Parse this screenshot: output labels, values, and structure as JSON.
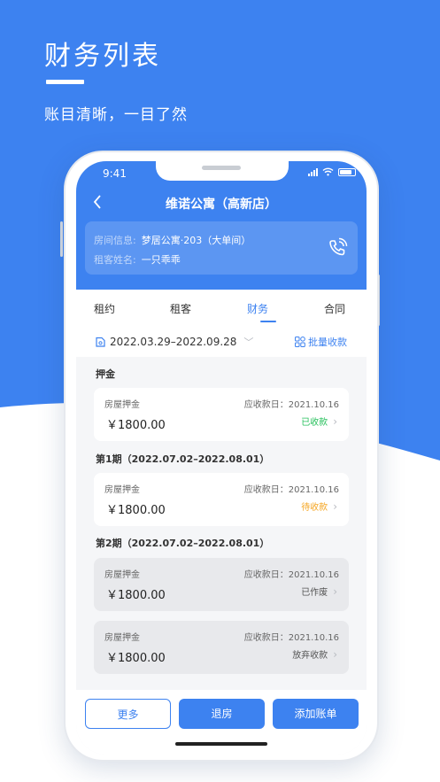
{
  "colors": {
    "brand_blue": "#3d82f0",
    "paid_green": "#27c05c",
    "pending_orange": "#f5a623"
  },
  "promo": {
    "title": "财务列表",
    "subtitle": "账目清晰，一目了然"
  },
  "status_bar": {
    "time": "9:41"
  },
  "header": {
    "title": "维诺公寓（高新店）",
    "room_label": "房间信息:",
    "room_value": "梦居公寓·203（大单间）",
    "tenant_label": "租客姓名:",
    "tenant_value": "一只乖乖"
  },
  "tabs": [
    {
      "label": "租约",
      "active": false
    },
    {
      "label": "租客",
      "active": false
    },
    {
      "label": "财务",
      "active": true
    },
    {
      "label": "合同",
      "active": false
    }
  ],
  "filter": {
    "date_range": "2022.03.29–2022.09.28",
    "batch_label": "批量收款"
  },
  "sections": [
    {
      "title": "押金",
      "items": [
        {
          "name": "房屋押金",
          "due": "应收款日：2021.10.16",
          "amount": "￥1800.00",
          "status": "已收款",
          "state": "paid"
        }
      ]
    },
    {
      "title": "第1期（2022.07.02–2022.08.01）",
      "items": [
        {
          "name": "房屋押金",
          "due": "应收款日：2021.10.16",
          "amount": "￥1800.00",
          "status": "待收款",
          "state": "pending"
        }
      ]
    },
    {
      "title": "第2期（2022.07.02–2022.08.01）",
      "items": [
        {
          "name": "房屋押金",
          "due": "应收款日：2021.10.16",
          "amount": "￥1800.00",
          "status": "已作废",
          "state": "void"
        },
        {
          "name": "房屋押金",
          "due": "应收款日：2021.10.16",
          "amount": "￥1800.00",
          "status": "放弃收款",
          "state": "waived"
        }
      ]
    }
  ],
  "footer": {
    "more_label": "更多",
    "checkout_label": "退房",
    "add_bill_label": "添加账单"
  }
}
